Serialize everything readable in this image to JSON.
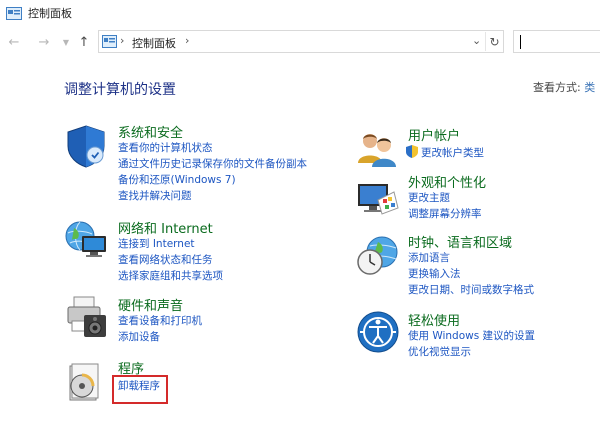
{
  "window": {
    "title": "控制面板"
  },
  "nav": {
    "back_icon": "back-arrow-icon",
    "forward_icon": "forward-arrow-icon",
    "recent_icon": "chevron-down-icon",
    "up_icon": "up-arrow-icon",
    "breadcrumb": [
      "控制面板"
    ],
    "search_placeholder": ""
  },
  "header": {
    "heading": "调整计算机的设置",
    "view_by_label": "查看方式: ",
    "view_by_value": "类"
  },
  "categories": [
    {
      "id": "system-security",
      "icon": "shield-icon",
      "title": "系统和安全",
      "links": [
        "查看你的计算机状态",
        "通过文件历史记录保存你的文件备份副本",
        "备份和还原(Windows 7)",
        "查找并解决问题"
      ]
    },
    {
      "id": "network",
      "icon": "network-globe-icon",
      "title": "网络和 Internet",
      "links": [
        "连接到 Internet",
        "查看网络状态和任务",
        "选择家庭组和共享选项"
      ]
    },
    {
      "id": "hardware",
      "icon": "printer-speaker-icon",
      "title": "硬件和声音",
      "links": [
        "查看设备和打印机",
        "添加设备"
      ]
    },
    {
      "id": "programs",
      "icon": "program-disc-icon",
      "title": "程序",
      "links": [
        "卸载程序"
      ]
    },
    {
      "id": "user-accounts",
      "icon": "users-icon",
      "title": "用户帐户",
      "links": [
        "更改帐户类型"
      ]
    },
    {
      "id": "appearance",
      "icon": "monitor-palette-icon",
      "title": "外观和个性化",
      "links": [
        "更改主题",
        "调整屏幕分辨率"
      ]
    },
    {
      "id": "clock-region",
      "icon": "clock-globe-icon",
      "title": "时钟、语言和区域",
      "links": [
        "添加语言",
        "更换输入法",
        "更改日期、时间或数字格式"
      ]
    },
    {
      "id": "ease-of-access",
      "icon": "ease-of-access-icon",
      "title": "轻松使用",
      "links": [
        "使用 Windows 建议的设置",
        "优化视觉显示"
      ]
    }
  ],
  "colors": {
    "category_title": "#0a6b1e",
    "link": "#1d56c2",
    "heading": "#1e3287",
    "highlight": "#d42a2a"
  }
}
